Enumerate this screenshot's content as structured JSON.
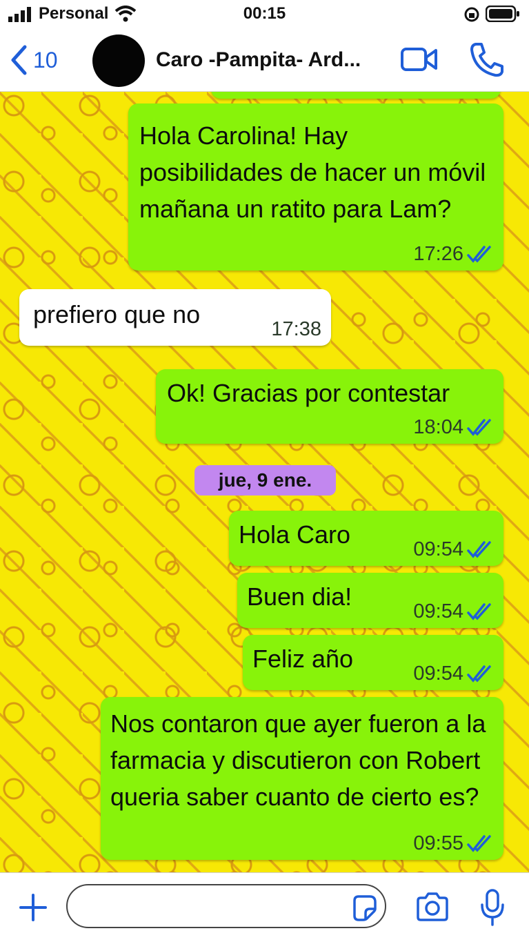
{
  "status_bar": {
    "carrier": "Personal",
    "time": "00:15"
  },
  "header": {
    "back_count": "10",
    "contact_name": "Caro -Pampita- Ard..."
  },
  "chat": {
    "date_separator": "jue, 9 ene.",
    "messages": [
      {
        "direction": "outgoing",
        "text": "Hola Carolina! Hay posibilidades de hacer un móvil mañana un ratito para Lam?",
        "time": "17:26",
        "status": "read"
      },
      {
        "direction": "incoming",
        "text": "prefiero que no",
        "time": "17:38"
      },
      {
        "direction": "outgoing",
        "text": "Ok! Gracias por contestar",
        "time": "18:04",
        "status": "read"
      },
      {
        "direction": "outgoing",
        "text": "Hola Caro",
        "time": "09:54",
        "status": "read"
      },
      {
        "direction": "outgoing",
        "text": "Buen dia!",
        "time": "09:54",
        "status": "read"
      },
      {
        "direction": "outgoing",
        "text": "Feliz año",
        "time": "09:54",
        "status": "read"
      },
      {
        "direction": "outgoing",
        "text": "Nos contaron que ayer fueron a la farmacia y discutieron con Robert queria saber cuanto de cierto es?",
        "time": "09:55",
        "status": "read"
      }
    ]
  },
  "input_bar": {
    "placeholder": ""
  },
  "colors": {
    "accent": "#1f5ed8",
    "outgoing_bubble": "#88f30a",
    "incoming_bubble": "#ffffff",
    "chat_background": "#f7e805",
    "date_chip": "#c287ef",
    "read_ticks": "#1f5ed8"
  },
  "icons": {
    "signal": "signal-bars-icon",
    "wifi": "wifi-icon",
    "orientation_lock": "orientation-lock-icon",
    "battery": "battery-icon",
    "back": "chevron-left-icon",
    "video": "video-camera-icon",
    "call": "phone-icon",
    "read_receipt": "double-check-icon",
    "attach": "plus-icon",
    "sticker": "sticker-icon",
    "camera": "camera-icon",
    "mic": "microphone-icon"
  }
}
